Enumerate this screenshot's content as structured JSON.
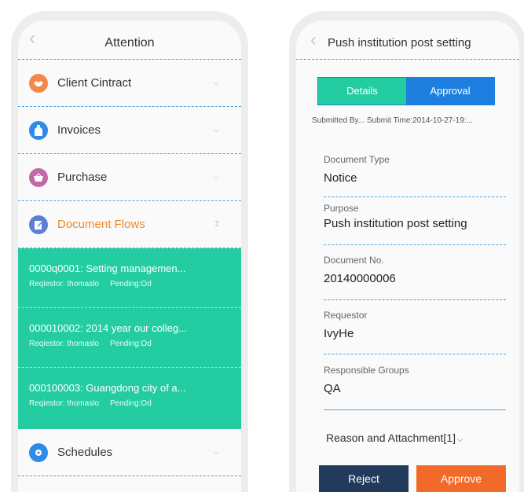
{
  "left": {
    "title": "Attention",
    "sections": [
      {
        "label": "Client Cintract",
        "icon": "handshake-icon",
        "color": "#f2894b"
      },
      {
        "label": "Invoices",
        "icon": "bottle-icon",
        "color": "#2f8be8"
      },
      {
        "label": "Purchase",
        "icon": "basket-icon",
        "color": "#c26aa8"
      },
      {
        "label": "Document Flows",
        "icon": "document-icon",
        "color": "#5c7fd6"
      }
    ],
    "flows": [
      {
        "title": "0000q0001: Setting managemen...",
        "requestor": "Reqiestor: thomaslo",
        "status": "Pending:Od"
      },
      {
        "title": "000010002: 2014 year our colleg...",
        "requestor": "Reqiestor: thomaslo",
        "status": "Pending:Od"
      },
      {
        "title": "000100003: Guangdong city of a...",
        "requestor": "Reqiestor: thomaslo",
        "status": "Pending:Od"
      }
    ],
    "schedules": {
      "label": "Schedules",
      "icon": "schedule-icon",
      "color": "#2f8be8"
    }
  },
  "right": {
    "title": "Push institution post setting",
    "tabs": [
      "Details",
      "Approval"
    ],
    "submitted": "Submitted By... Submit Time:2014-10-27-19:...",
    "fields": [
      {
        "label": "Document Type",
        "value": "Notice"
      },
      {
        "label": "Purpose",
        "value": "Push institution post setting"
      },
      {
        "label": "Document No.",
        "value": "20140000006"
      },
      {
        "label": "Requestor",
        "value": "IvyHe"
      },
      {
        "label": "Responsible Groups",
        "value": "QA"
      }
    ],
    "reason": "Reason and Attachment[1]",
    "reject": "Reject",
    "approve": "Approve"
  }
}
